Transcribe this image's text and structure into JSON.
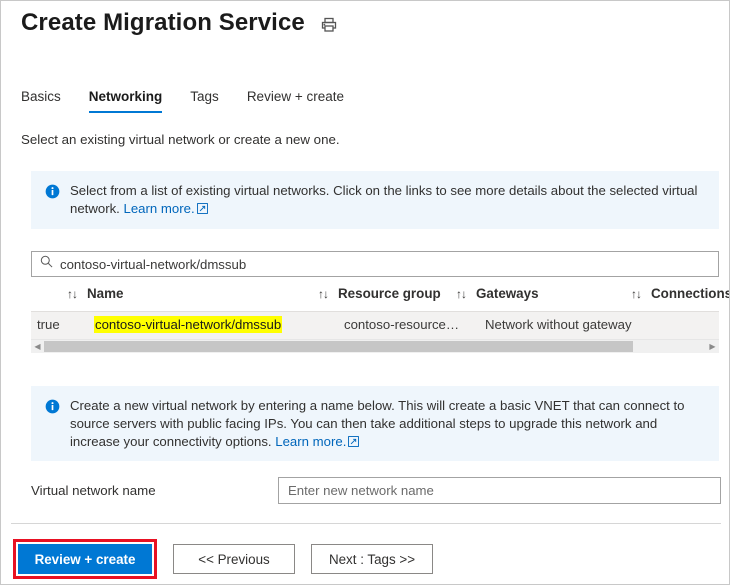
{
  "header": {
    "title": "Create Migration Service",
    "print_icon": "printer-icon"
  },
  "tabs": [
    {
      "label": "Basics",
      "active": false
    },
    {
      "label": "Networking",
      "active": true
    },
    {
      "label": "Tags",
      "active": false
    },
    {
      "label": "Review + create",
      "active": false
    }
  ],
  "intro_text": "Select an existing virtual network or create a new one.",
  "info_banners": [
    {
      "icon": "info-icon",
      "text": "Select from a list of existing virtual networks. Click on the links to see more details about the selected virtual network.",
      "link_label": "Learn more.",
      "link_icon": "external-link-icon"
    },
    {
      "icon": "info-icon",
      "text": "Create a new virtual network by entering a name below. This will create a basic VNET that can connect to source servers with public facing IPs. You can then take additional steps to upgrade this network and increase your connectivity options.",
      "link_label": "Learn more.",
      "link_icon": "external-link-icon"
    }
  ],
  "search": {
    "icon": "search-icon",
    "value": "contoso-virtual-network/dmssub",
    "placeholder": "Search"
  },
  "table": {
    "sort_glyph": "↑↓",
    "columns": [
      {
        "label": "Name",
        "sortable": true
      },
      {
        "label": "Resource group",
        "sortable": true
      },
      {
        "label": "Gateways",
        "sortable": true
      },
      {
        "label": "Connections",
        "sortable": true
      }
    ],
    "rows": [
      {
        "selected": "true",
        "name": "contoso-virtual-network/dmssub",
        "name_highlighted": true,
        "resource_group": "contoso-resource…",
        "gateways": "Network without gateway",
        "connections": ""
      }
    ],
    "scrollbar": {
      "left_arrow": "◀",
      "right_arrow": "▶"
    }
  },
  "virtual_network_name": {
    "label": "Virtual network name",
    "value": "",
    "placeholder": "Enter new network name"
  },
  "footer": {
    "buttons": [
      {
        "label": "Review + create",
        "style": "primary",
        "highlighted": true
      },
      {
        "label": "<< Previous",
        "style": "secondary",
        "highlighted": false
      },
      {
        "label": "Next : Tags >>",
        "style": "secondary",
        "highlighted": false
      }
    ]
  },
  "colors": {
    "accent": "#0078d4",
    "info_banner_bg": "#eff6fc",
    "highlight_yellow": "#ffff00",
    "highlight_red": "#e81123",
    "row_bg": "#f3f2f1",
    "link": "#0066bb"
  }
}
